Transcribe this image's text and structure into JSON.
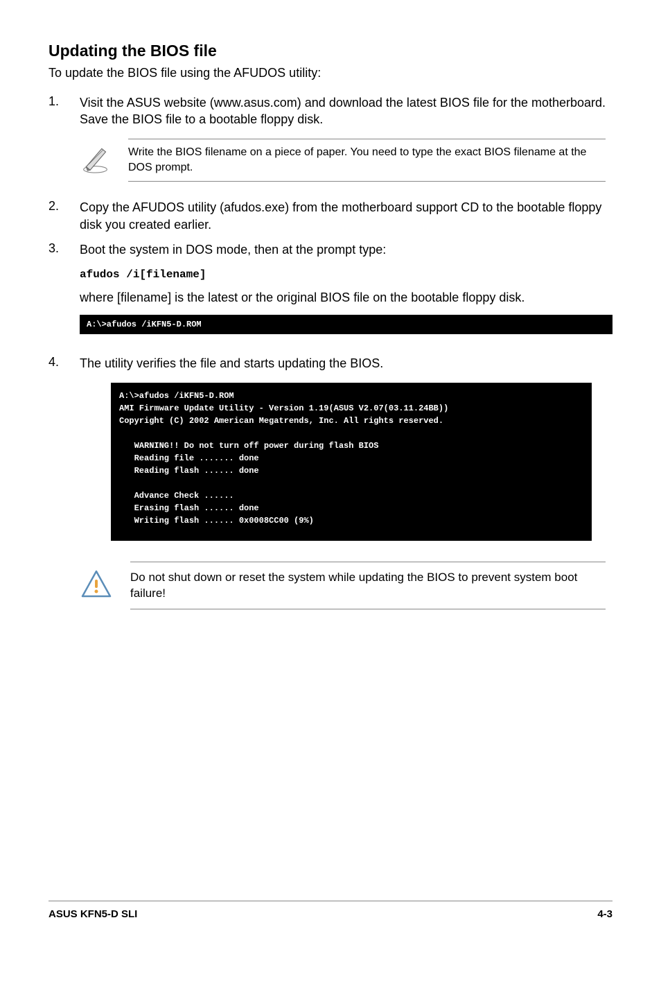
{
  "heading": "Updating the BIOS file",
  "intro": "To update the BIOS file using the AFUDOS utility:",
  "step1_num": "1.",
  "step1_text": "Visit the ASUS website (www.asus.com) and download the latest BIOS file for the motherboard. Save the BIOS file to a bootable floppy disk.",
  "note1": "Write the BIOS filename on a piece of paper. You need to type the exact BIOS filename at the DOS prompt.",
  "step2_num": "2.",
  "step2_text": "Copy the AFUDOS utility (afudos.exe) from the motherboard support CD to the bootable floppy disk you created earlier.",
  "step3_num": "3.",
  "step3_text": "Boot the system in DOS mode, then at the prompt type:",
  "cmd": "afudos /i[filename]",
  "step3_sub": "where [filename] is the latest or the original BIOS file on the bootable floppy disk.",
  "terminal1": "A:\\>afudos /iKFN5-D.ROM",
  "step4_num": "4.",
  "step4_text": "The utility verifies the file and starts updating the BIOS.",
  "terminal2": "A:\\>afudos /iKFN5-D.ROM\nAMI Firmware Update Utility - Version 1.19(ASUS V2.07(03.11.24BB))\nCopyright (C) 2002 American Megatrends, Inc. All rights reserved.\n\n   WARNING!! Do not turn off power during flash BIOS\n   Reading file ....... done\n   Reading flash ...... done\n\n   Advance Check ......\n   Erasing flash ...... done\n   Writing flash ...... 0x0008CC00 (9%)",
  "warning": "Do not shut down or reset the system while updating the BIOS to prevent system boot failure!",
  "footer_left": "ASUS KFN5-D SLI",
  "footer_right": "4-3"
}
